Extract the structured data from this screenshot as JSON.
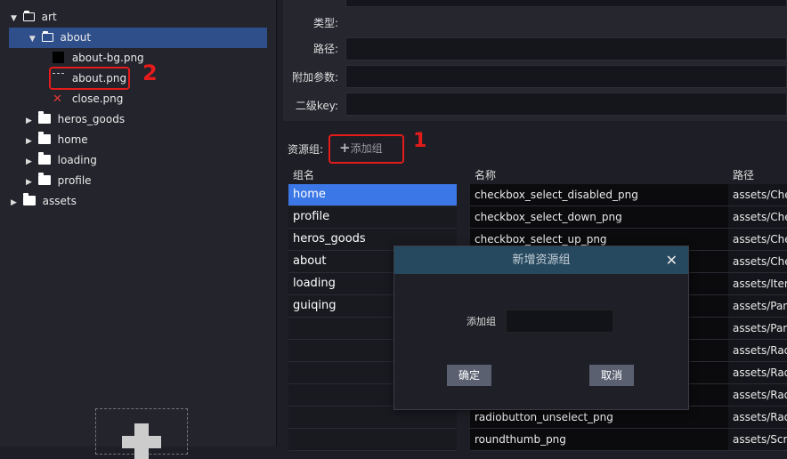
{
  "tree": {
    "items": [
      {
        "label": "art",
        "kind": "folder-open",
        "expanded": true
      },
      {
        "label": "about",
        "kind": "folder-open",
        "expanded": true,
        "selected": true
      },
      {
        "label": "about-bg.png",
        "kind": "image-black"
      },
      {
        "label": "about.png",
        "kind": "image-dashed"
      },
      {
        "label": "close.png",
        "kind": "image-x"
      },
      {
        "label": "heros_goods",
        "kind": "folder"
      },
      {
        "label": "home",
        "kind": "folder"
      },
      {
        "label": "loading",
        "kind": "folder"
      },
      {
        "label": "profile",
        "kind": "folder"
      },
      {
        "label": "assets",
        "kind": "folder"
      }
    ],
    "annotation_2": "2"
  },
  "form": {
    "type_label": "类型:",
    "path_label": "路径:",
    "params_label": "附加参数:",
    "subkey_label": "二级key:"
  },
  "resource_group": {
    "label": "资源组:",
    "add_label": "添加组",
    "annotation_1": "1"
  },
  "groups": {
    "header": "组名",
    "items": [
      "home",
      "profile",
      "heros_goods",
      "about",
      "loading",
      "guiqing",
      "",
      "",
      "",
      "",
      "",
      ""
    ],
    "active_index": 0
  },
  "resources": {
    "name_header": "名称",
    "path_header": "路径",
    "rows": [
      {
        "name": "checkbox_select_disabled_png",
        "path": "assets/Chec"
      },
      {
        "name": "checkbox_select_down_png",
        "path": "assets/Chec"
      },
      {
        "name": "checkbox_select_up_png",
        "path": "assets/Chec"
      },
      {
        "name": "",
        "path": "assets/Chec"
      },
      {
        "name": "",
        "path": "assets/Item"
      },
      {
        "name": "",
        "path": "assets/Pane"
      },
      {
        "name": "",
        "path": "assets/Pane"
      },
      {
        "name": "",
        "path": "assets/Radi"
      },
      {
        "name": "",
        "path": "assets/Radi"
      },
      {
        "name": "",
        "path": "assets/Radi"
      },
      {
        "name": "radiobutton_unselect_png",
        "path": "assets/Radi"
      },
      {
        "name": "roundthumb_png",
        "path": "assets/Scro"
      }
    ]
  },
  "modal": {
    "title": "新增资源组",
    "close_icon": "close-icon",
    "field_label": "添加组",
    "field_value": "",
    "ok_label": "确定",
    "cancel_label": "取消"
  }
}
